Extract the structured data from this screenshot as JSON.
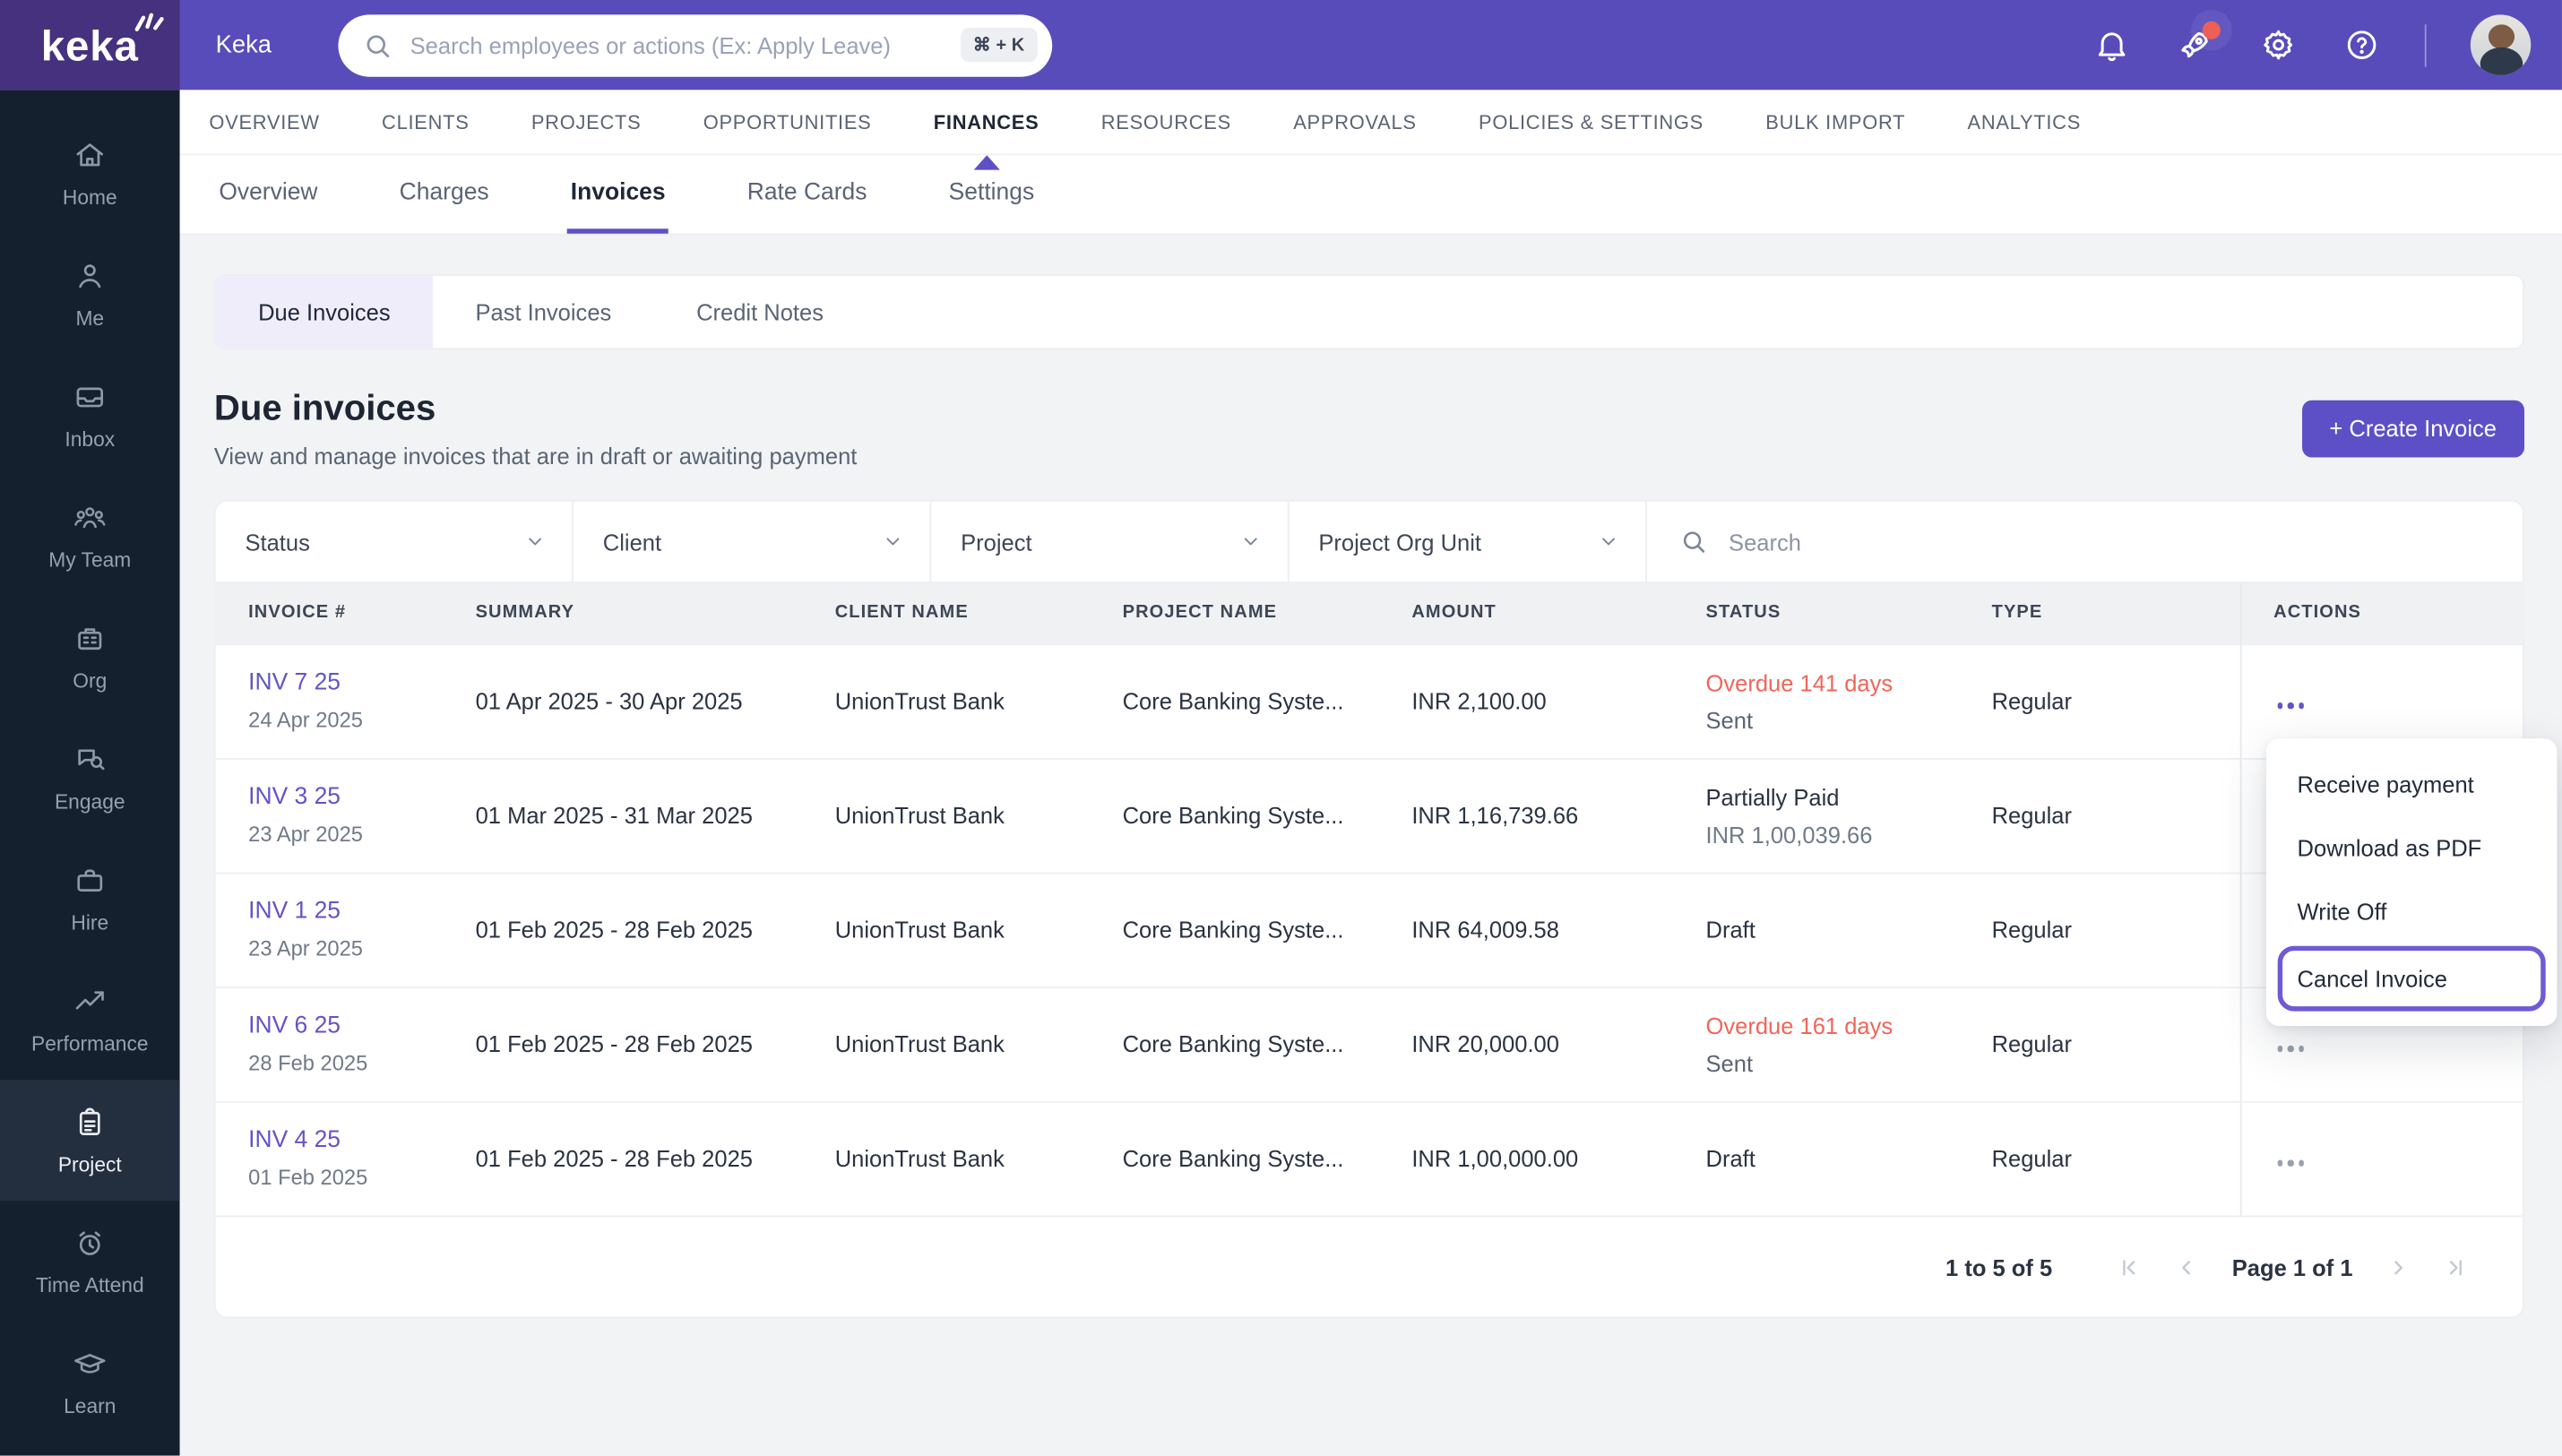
{
  "topbar": {
    "brand": "keka",
    "app_label": "Keka",
    "search_placeholder": "Search employees or actions (Ex: Apply Leave)",
    "shortcut": "⌘ + K"
  },
  "sidebar": {
    "active": "Project",
    "items": [
      {
        "label": "Home",
        "icon": "home-icon"
      },
      {
        "label": "Me",
        "icon": "person-icon"
      },
      {
        "label": "Inbox",
        "icon": "inbox-icon"
      },
      {
        "label": "My Team",
        "icon": "team-icon"
      },
      {
        "label": "Org",
        "icon": "building-icon"
      },
      {
        "label": "Engage",
        "icon": "engage-icon"
      },
      {
        "label": "Hire",
        "icon": "briefcase-icon"
      },
      {
        "label": "Performance",
        "icon": "trend-icon"
      },
      {
        "label": "Project",
        "icon": "clipboard-icon"
      },
      {
        "label": "Time Attend",
        "icon": "alarm-icon"
      },
      {
        "label": "Learn",
        "icon": "graduation-icon"
      }
    ]
  },
  "main_nav": {
    "active": "FINANCES",
    "items": [
      {
        "label": "OVERVIEW"
      },
      {
        "label": "CLIENTS"
      },
      {
        "label": "PROJECTS"
      },
      {
        "label": "OPPORTUNITIES"
      },
      {
        "label": "FINANCES"
      },
      {
        "label": "RESOURCES"
      },
      {
        "label": "APPROVALS"
      },
      {
        "label": "POLICIES & SETTINGS"
      },
      {
        "label": "BULK IMPORT"
      },
      {
        "label": "ANALYTICS"
      }
    ]
  },
  "sub_nav": {
    "active": "Invoices",
    "items": [
      {
        "label": "Overview"
      },
      {
        "label": "Charges"
      },
      {
        "label": "Invoices"
      },
      {
        "label": "Rate Cards"
      },
      {
        "label": "Settings"
      }
    ]
  },
  "tabs": {
    "active": "Due Invoices",
    "items": [
      {
        "label": "Due Invoices"
      },
      {
        "label": "Past Invoices"
      },
      {
        "label": "Credit Notes"
      }
    ]
  },
  "page": {
    "title": "Due invoices",
    "subtitle": "View and manage invoices that are in draft or awaiting payment",
    "create_button": "+ Create Invoice"
  },
  "filters": {
    "dropdowns": [
      {
        "label": "Status"
      },
      {
        "label": "Client"
      },
      {
        "label": "Project"
      },
      {
        "label": "Project Org Unit"
      }
    ],
    "search_placeholder": "Search"
  },
  "table": {
    "columns": {
      "invoice": "INVOICE #",
      "summary": "SUMMARY",
      "client": "CLIENT NAME",
      "project": "PROJECT NAME",
      "amount": "AMOUNT",
      "status": "STATUS",
      "type": "TYPE",
      "actions": "ACTIONS"
    },
    "rows": [
      {
        "invoice": "INV 7 25",
        "date": "24 Apr 2025",
        "summary": "01 Apr 2025 - 30 Apr 2025",
        "client": "UnionTrust Bank",
        "project": "Core Banking Syste...",
        "amount": "INR 2,100.00",
        "status": "Overdue 141 days",
        "status_sub": "Sent",
        "type": "Regular"
      },
      {
        "invoice": "INV 3 25",
        "date": "23 Apr 2025",
        "summary": "01 Mar 2025 - 31 Mar 2025",
        "client": "UnionTrust Bank",
        "project": "Core Banking Syste...",
        "amount": "INR 1,16,739.66",
        "status": "Partially Paid",
        "status_sub": "INR 1,00,039.66",
        "type": "Regular"
      },
      {
        "invoice": "INV 1 25",
        "date": "23 Apr 2025",
        "summary": "01 Feb 2025 - 28 Feb 2025",
        "client": "UnionTrust Bank",
        "project": "Core Banking Syste...",
        "amount": "INR 64,009.58",
        "status": "Draft",
        "status_sub": "",
        "type": "Regular"
      },
      {
        "invoice": "INV 6 25",
        "date": "28 Feb 2025",
        "summary": "01 Feb 2025 - 28 Feb 2025",
        "client": "UnionTrust Bank",
        "project": "Core Banking Syste...",
        "amount": "INR 20,000.00",
        "status": "Overdue 161 days",
        "status_sub": "Sent",
        "type": "Regular"
      },
      {
        "invoice": "INV 4 25",
        "date": "01 Feb 2025",
        "summary": "01 Feb 2025 - 28 Feb 2025",
        "client": "UnionTrust Bank",
        "project": "Core Banking Syste...",
        "amount": "INR 1,00,000.00",
        "status": "Draft",
        "status_sub": "",
        "type": "Regular"
      }
    ]
  },
  "context_menu": {
    "highlighted": "Cancel Invoice",
    "items": [
      {
        "label": "Receive payment"
      },
      {
        "label": "Download as PDF"
      },
      {
        "label": "Write Off"
      },
      {
        "label": "Cancel Invoice"
      }
    ]
  },
  "pagination": {
    "range": "1 to 5 of 5",
    "page": "Page 1 of 1"
  },
  "colors": {
    "accent": "#5D50C6",
    "topbar": "#584CBB",
    "logo_block": "#46317E",
    "sidebar": "#15202E",
    "overdue_red": "#F0655A",
    "link_purple": "#6254C6",
    "page_bg": "#F2F3F5"
  }
}
